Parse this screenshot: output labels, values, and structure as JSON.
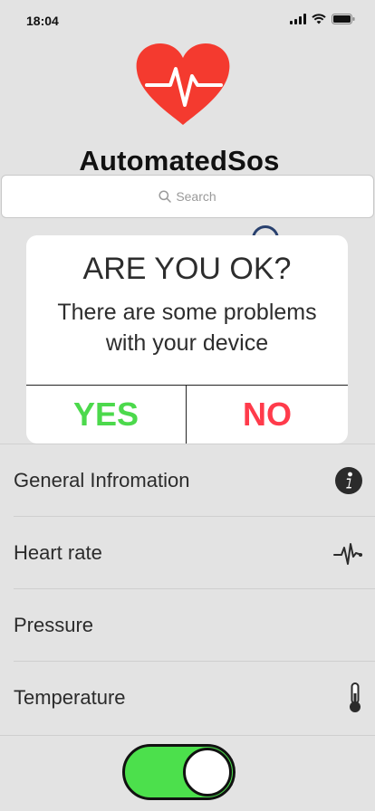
{
  "status_bar": {
    "time": "18:04",
    "icons": [
      "cellular-signal-icon",
      "wifi-icon",
      "battery-icon"
    ]
  },
  "app": {
    "title": "AutomatedSos",
    "logo_icon": "heart-pulse-icon",
    "logo_color": "#f43a2f"
  },
  "search": {
    "placeholder": "Search",
    "icon": "search-icon"
  },
  "alert": {
    "title": "ARE YOU OK?",
    "message": "There are some problems with your device",
    "yes_label": "YES",
    "no_label": "NO",
    "yes_color": "#4cd94c",
    "no_color": "#ff3b4b"
  },
  "list": {
    "items": [
      {
        "label": "General Infromation",
        "icon": "info-icon"
      },
      {
        "label": "Heart rate",
        "icon": "pulse-icon"
      },
      {
        "label": "Pressure",
        "icon": ""
      },
      {
        "label": "Temperature",
        "icon": "thermometer-icon"
      }
    ]
  },
  "toggle": {
    "state": "on",
    "on_color": "#4ce04c"
  }
}
